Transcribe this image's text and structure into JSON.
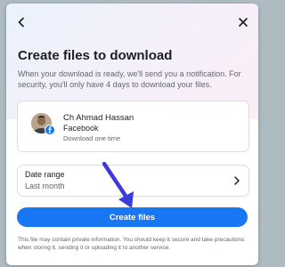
{
  "dialog": {
    "title": "Create files to download",
    "description": "When your download is ready, we'll send you a notification. For security, you'll only have 4 days to download your files.",
    "back_icon": "chevron-left-icon",
    "close_icon": "close-icon"
  },
  "account": {
    "name": "Ch Ahmad Hassan",
    "platform": "Facebook",
    "note": "Download one time",
    "badge_icon": "facebook-icon"
  },
  "date_range": {
    "label": "Date range",
    "value": "Last month",
    "icon": "chevron-right-icon"
  },
  "create_button": {
    "label": "Create files",
    "color": "#1877f2"
  },
  "footnote": "This file may contain private information. You should keep it secure and take precautions when storing it, sending it or uploading it to another service.",
  "annotation": {
    "arrow_color": "#3b3bd9"
  }
}
